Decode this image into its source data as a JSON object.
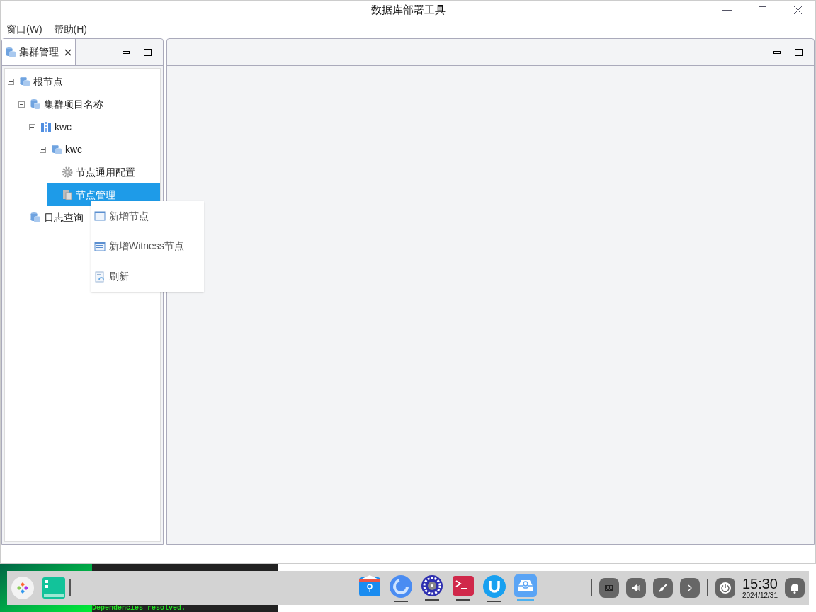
{
  "window": {
    "title": "数据库部署工具"
  },
  "menu": [
    {
      "label": "窗口(W)"
    },
    {
      "label": "帮助(H)"
    }
  ],
  "left_panel": {
    "tab": {
      "label": "集群管理",
      "selected": true
    },
    "tree": [
      {
        "label": "根节点",
        "kind": "db",
        "expanded": true,
        "selected": false,
        "children": [
          {
            "label": "集群项目名称",
            "kind": "db",
            "expanded": true,
            "selected": false,
            "children": [
              {
                "label": "kwc",
                "kind": "cluster",
                "expanded": true,
                "selected": false,
                "children": [
                  {
                    "label": "kwc",
                    "kind": "db",
                    "expanded": true,
                    "selected": false,
                    "children": [
                      {
                        "label": "节点通用配置",
                        "kind": "gear",
                        "selected": false
                      },
                      {
                        "label": "节点管理",
                        "kind": "server",
                        "selected": true
                      }
                    ]
                  }
                ]
              }
            ]
          },
          {
            "label": "日志查询",
            "kind": "db",
            "selected": false
          }
        ]
      }
    ]
  },
  "context_menu": [
    {
      "label": "新增节点",
      "kind": "form"
    },
    {
      "label": "新增Witness节点",
      "kind": "form"
    },
    {
      "label": "刷新",
      "kind": "refresh"
    }
  ],
  "terminal": {
    "line": "Dependencies resolved."
  },
  "taskbar": {
    "apps": [
      {
        "kind": "files",
        "active": false,
        "selected": false
      },
      {
        "kind": "browser",
        "active": true,
        "selected": false
      },
      {
        "kind": "settings",
        "active": true,
        "selected": false
      },
      {
        "kind": "terminal",
        "active": true,
        "selected": false
      },
      {
        "kind": "u",
        "active": true,
        "selected": false
      },
      {
        "kind": "deploy",
        "active": true,
        "selected": true
      }
    ],
    "time": "15:30",
    "date": "2024/12/31"
  }
}
